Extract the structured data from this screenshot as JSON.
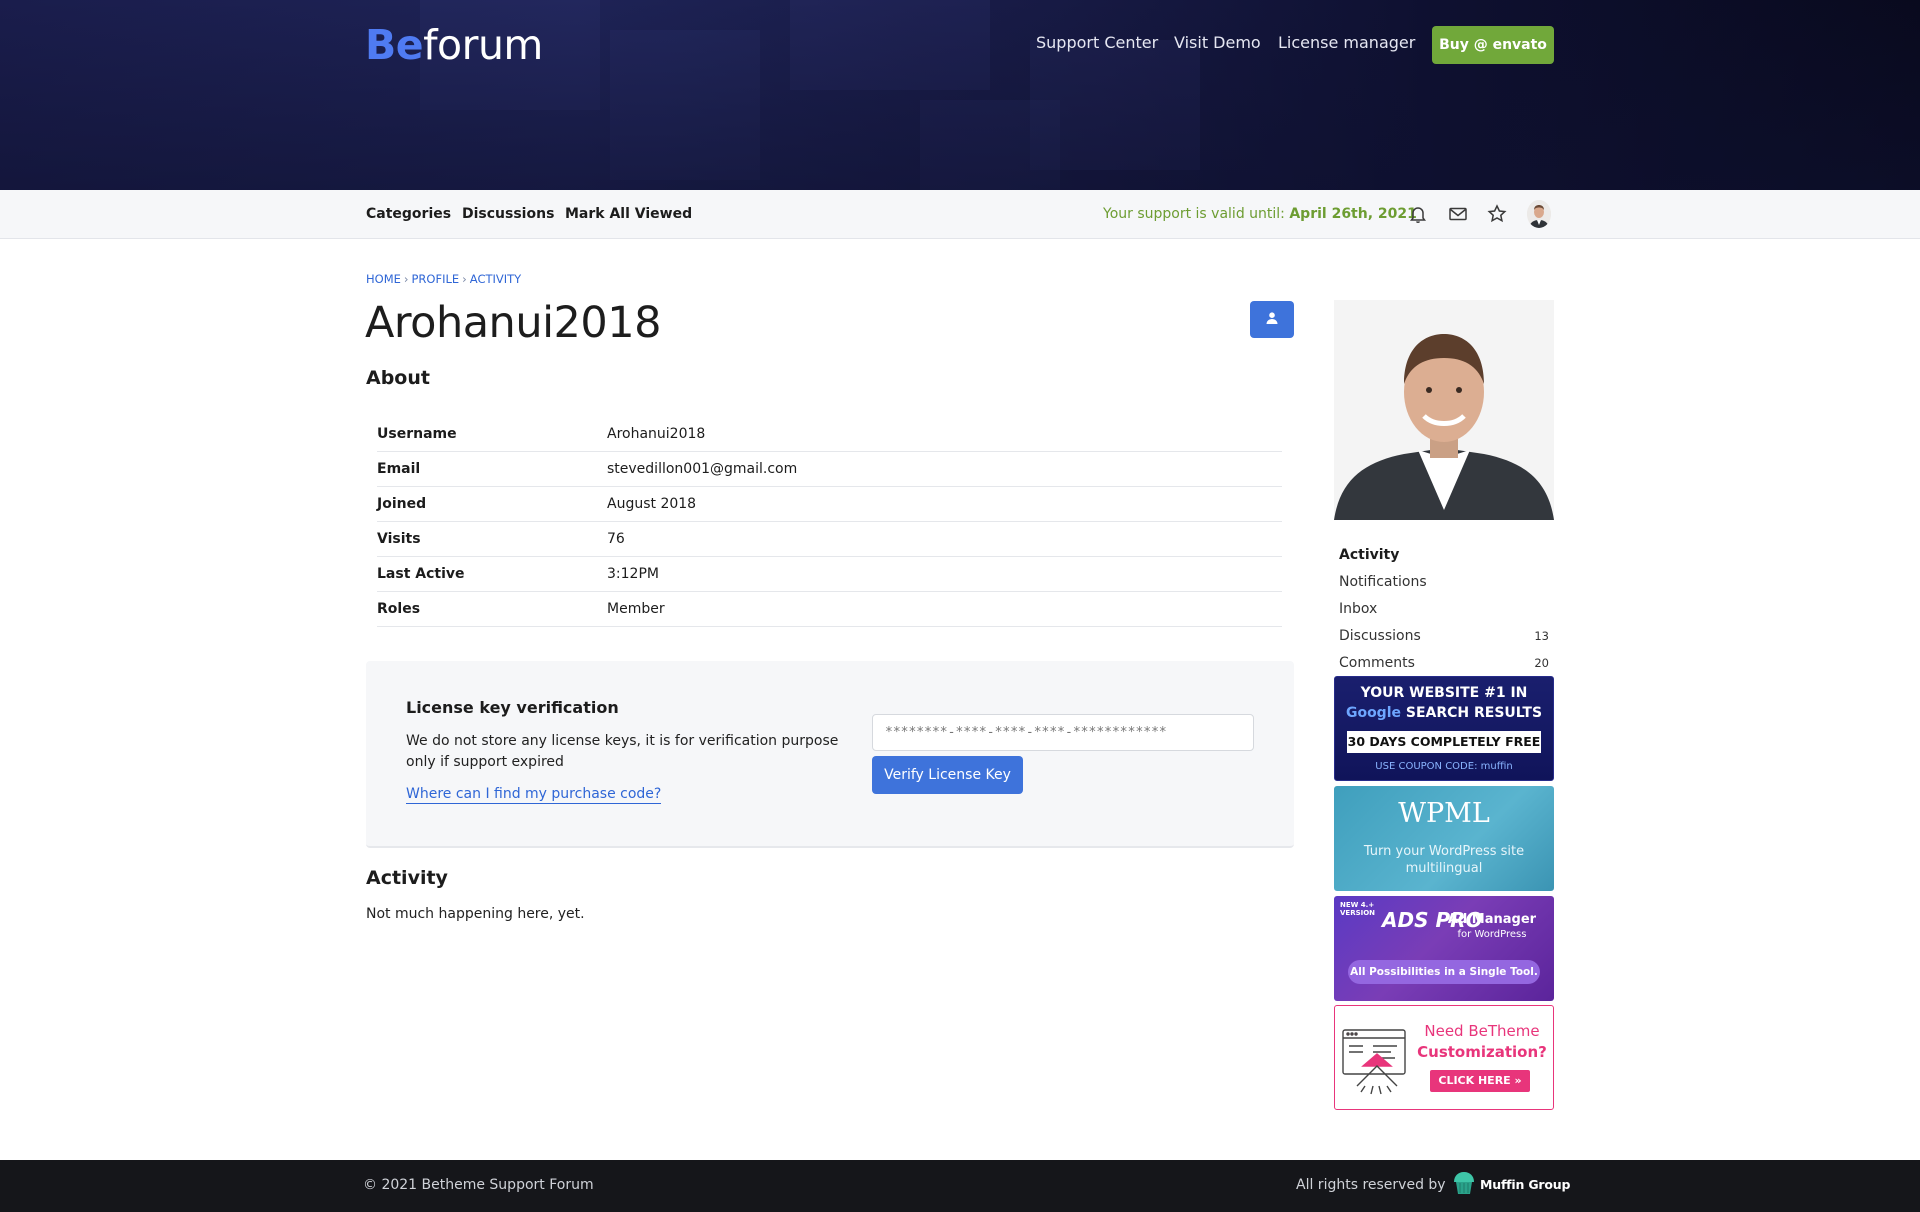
{
  "header": {
    "logo_be": "Be",
    "logo_rest": "forum",
    "nav": [
      "Support Center",
      "Visit Demo",
      "License manager"
    ],
    "buy_label": "Buy @ envato"
  },
  "subnav": {
    "links": [
      "Categories",
      "Discussions",
      "Mark All Viewed"
    ],
    "support_prefix": "Your support is valid until: ",
    "support_date": "April 26th, 2021",
    "icons": [
      "bell-icon",
      "mail-icon",
      "star-icon"
    ]
  },
  "breadcrumb": [
    "HOME",
    "PROFILE",
    "ACTIVITY"
  ],
  "profile": {
    "title": "Arohanui2018",
    "about_heading": "About",
    "fields": [
      {
        "key": "Username",
        "value": "Arohanui2018"
      },
      {
        "key": "Email",
        "value": "stevedillon001@gmail.com"
      },
      {
        "key": "Joined",
        "value": "August 2018"
      },
      {
        "key": "Visits",
        "value": "76"
      },
      {
        "key": "Last Active",
        "value": "3:12PM"
      },
      {
        "key": "Roles",
        "value": "Member"
      }
    ]
  },
  "license": {
    "heading": "License key verification",
    "description": "We do not store any license keys, it is for verification purpose only if support expired",
    "help_link": "Where can I find my purchase code?",
    "placeholder": "********-****-****-****-************",
    "button": "Verify License Key"
  },
  "activity": {
    "heading": "Activity",
    "empty_text": "Not much happening here, yet."
  },
  "sidebar": {
    "menu": [
      {
        "label": "Activity",
        "count": ""
      },
      {
        "label": "Notifications",
        "count": ""
      },
      {
        "label": "Inbox",
        "count": ""
      },
      {
        "label": "Discussions",
        "count": "13"
      },
      {
        "label": "Comments",
        "count": "20"
      }
    ],
    "ads": {
      "ad1": {
        "line1": "YOUR WEBSITE #1 IN",
        "line2a": "Google",
        "line2b": "SEARCH RESULTS",
        "line3": "30 DAYS COMPLETELY FREE",
        "line4": "USE COUPON CODE: muffin"
      },
      "ad2": {
        "brand": "WPML",
        "tagline": "Turn your WordPress site multilingual"
      },
      "ad3": {
        "badge": "NEW 4.+ VERSION",
        "brand": "ADS PRO",
        "title": "Ad Manager",
        "sub": "for WordPress",
        "pill": "All Possibilities in a Single Tool."
      },
      "ad4": {
        "line1": "Need BeTheme",
        "line2": "Customization?",
        "cta": "CLICK HERE »"
      }
    }
  },
  "footer": {
    "copyright": "© 2021 Betheme Support Forum",
    "rights": "All rights reserved by",
    "brand": "Muffin Group"
  },
  "colors": {
    "accent_blue": "#3e73db",
    "buy_green": "#71a83a",
    "support_green": "#6d9d32",
    "link_blue": "#2f66d6"
  }
}
